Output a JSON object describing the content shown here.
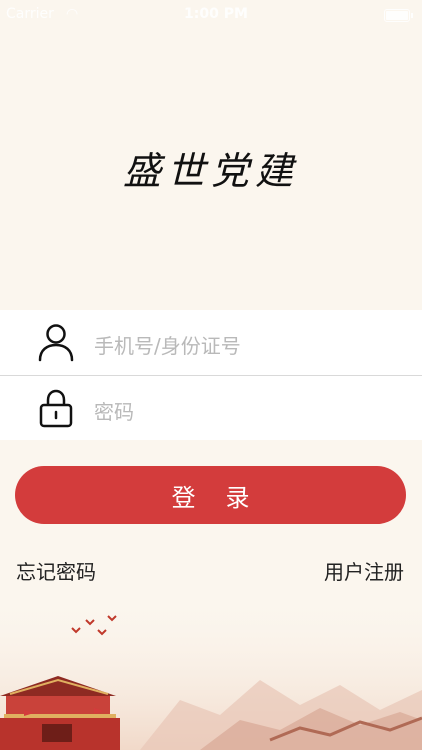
{
  "status_bar": {
    "carrier": "Carrier",
    "time": "1:00 PM"
  },
  "app": {
    "logo_text": "盛世党建"
  },
  "form": {
    "phone_placeholder": "手机号/身份证号",
    "password_placeholder": "密码"
  },
  "actions": {
    "login_label": "登录",
    "forgot_password": "忘记密码",
    "register": "用户注册"
  },
  "colors": {
    "background": "#FBF6EE",
    "accent": "#D33C3C"
  },
  "icons": {
    "user": "user-icon",
    "lock": "lock-icon"
  }
}
